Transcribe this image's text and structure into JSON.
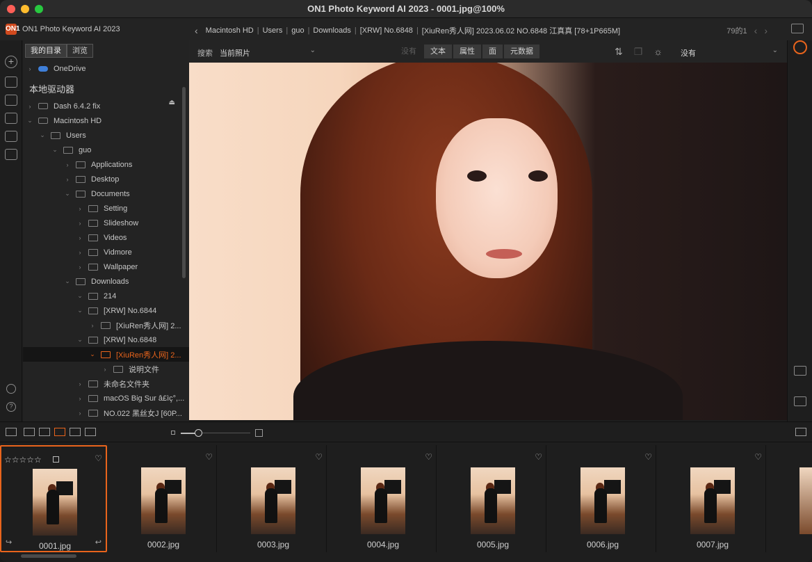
{
  "window": {
    "title": "ON1 Photo Keyword AI 2023 - 0001.jpg@100%"
  },
  "app": {
    "name": "ON1 Photo Keyword AI 2023",
    "logo": "ON1"
  },
  "breadcrumb": [
    "Macintosh HD",
    "Users",
    "guo",
    "Downloads",
    "[XRW] No.6848",
    "[XiuRen秀人网] 2023.06.02 NO.6848 江真真 [78+1P665M]"
  ],
  "nav": {
    "count": "79的1"
  },
  "sidebar": {
    "tabs": [
      "我的目录",
      "浏览"
    ],
    "cloud": "OneDrive",
    "section": "本地驱动器",
    "rows": [
      {
        "label": "Dash 6.4.2 fix",
        "indent": 0,
        "type": "drive",
        "exp": "›"
      },
      {
        "label": "Macintosh HD",
        "indent": 0,
        "type": "drive",
        "exp": "⌄"
      },
      {
        "label": "Users",
        "indent": 1,
        "type": "folder",
        "exp": "⌄"
      },
      {
        "label": "guo",
        "indent": 2,
        "type": "folder",
        "exp": "⌄"
      },
      {
        "label": "Applications",
        "indent": 3,
        "type": "folder",
        "exp": "›"
      },
      {
        "label": "Desktop",
        "indent": 3,
        "type": "folder",
        "exp": "›"
      },
      {
        "label": "Documents",
        "indent": 3,
        "type": "folder",
        "exp": "⌄"
      },
      {
        "label": "Setting",
        "indent": 4,
        "type": "folder",
        "exp": "›"
      },
      {
        "label": "Slideshow",
        "indent": 4,
        "type": "folder",
        "exp": "›"
      },
      {
        "label": "Videos",
        "indent": 4,
        "type": "folder",
        "exp": "›"
      },
      {
        "label": "Vidmore",
        "indent": 4,
        "type": "folder",
        "exp": "›"
      },
      {
        "label": "Wallpaper",
        "indent": 4,
        "type": "folder",
        "exp": "›"
      },
      {
        "label": "Downloads",
        "indent": 3,
        "type": "folder",
        "exp": "⌄"
      },
      {
        "label": "214",
        "indent": 4,
        "type": "folder",
        "exp": "⌄"
      },
      {
        "label": "[XRW] No.6844",
        "indent": 4,
        "type": "folder",
        "exp": "⌄"
      },
      {
        "label": "[XiuRen秀人网] 2...",
        "indent": 5,
        "type": "folder",
        "exp": "›"
      },
      {
        "label": "[XRW] No.6848",
        "indent": 4,
        "type": "folder",
        "exp": "⌄"
      },
      {
        "label": "[XiuRen秀人网] 2...",
        "indent": 5,
        "type": "folder",
        "exp": "⌄",
        "selected": true
      },
      {
        "label": "说明文件",
        "indent": 6,
        "type": "folder",
        "exp": "›"
      },
      {
        "label": "未命名文件夹",
        "indent": 4,
        "type": "folder",
        "exp": "›"
      },
      {
        "label": "macOS Big Sur â£ìç°,...",
        "indent": 4,
        "type": "folder",
        "exp": "›"
      },
      {
        "label": "NO.022 黑丝女J [60P...",
        "indent": 4,
        "type": "folder",
        "exp": "›"
      }
    ]
  },
  "toolbar": {
    "search_label": "搜索",
    "scope": "当前照片",
    "filters": [
      "没有",
      "文本",
      "属性",
      "面",
      "元数据"
    ],
    "lighting": "没有"
  },
  "filmstrip": [
    {
      "name": "0001.jpg",
      "selected": true
    },
    {
      "name": "0002.jpg"
    },
    {
      "name": "0003.jpg"
    },
    {
      "name": "0004.jpg"
    },
    {
      "name": "0005.jpg"
    },
    {
      "name": "0006.jpg"
    },
    {
      "name": "0007.jpg"
    }
  ],
  "stars": "☆☆☆☆☆",
  "colors": {
    "accent": "#e9641c",
    "cloud": "#3f7fd8"
  }
}
